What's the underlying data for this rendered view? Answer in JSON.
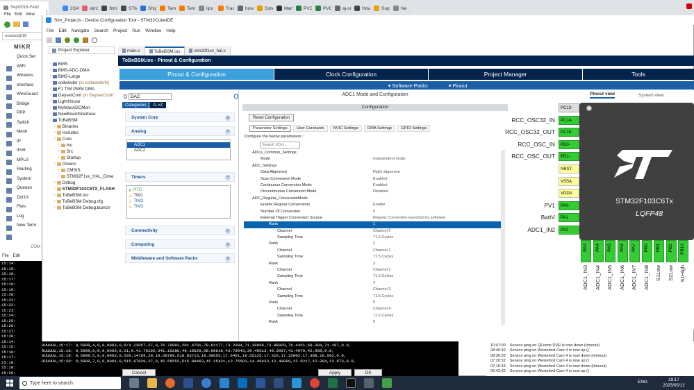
{
  "browser": {
    "active_tab_title": "Sept2018-Feb2",
    "tabs": [
      "2G4",
      "stm32",
      "Stm32",
      "STM3",
      "Shipm",
      "Temu",
      "Temu",
      "lipo b",
      "Track",
      "how t",
      "Solve",
      "Marke",
      "PVC D",
      "PVC D",
      "aj-sr0",
      "How t",
      "Suppo",
      "Ne"
    ],
    "menu": [
      "File",
      "Edit",
      "View"
    ]
  },
  "left_browser": {
    "address": "erastus@18",
    "logo": "MIKR",
    "items": [
      "Quick Set",
      "WiFi",
      "Wireless",
      "Interface",
      "WireGuard",
      "Bridge",
      "PPP",
      "Switch",
      "Mesh",
      "IP",
      "IPv6",
      "MPLS",
      "Routing",
      "System",
      "Queues",
      "Dot1X",
      "Files",
      "Log",
      "New Term"
    ],
    "com_label": "COM",
    "term_menu": [
      "File",
      "Edit"
    ],
    "times": [
      "15:14:",
      "15:15:",
      "15:16:",
      "15:17:",
      "15:18:",
      "15:19:",
      "15:20:",
      "15:21:",
      "15:22:",
      "15:23:",
      "15:24:",
      "15:25:",
      "15:26:",
      "15:27:",
      "15:28:",
      "15:14:",
      "15:15:",
      "15:16:",
      "15:17:",
      "15:18:",
      "15:19:",
      "15:20:"
    ]
  },
  "ide": {
    "title": "Stm_Projects - Device Configuration Tool - STM32CubeIDE",
    "menu": [
      "File",
      "Edit",
      "Navigate",
      "Search",
      "Project",
      "Run",
      "Window",
      "Help"
    ],
    "explorer_title": "Project Explorer",
    "editor_tabs": [
      "main.c",
      "ToBeBSM.ioc",
      "stm32f1xx_hal.c"
    ],
    "tree": [
      {
        "label": "BMS",
        "indent": 0,
        "sub": ""
      },
      {
        "label": "BMS-ADC-DMA",
        "indent": 0,
        "sub": ""
      },
      {
        "label": "BMS-Large",
        "indent": 0,
        "sub": ""
      },
      {
        "label": "coilwinder",
        "indent": 0,
        "sub": "(in coilwinderN)"
      },
      {
        "label": "F1 TIM PWM DMA",
        "indent": 0,
        "sub": ""
      },
      {
        "label": "GeyserCont",
        "indent": 0,
        "sub": "(in GeyserContr"
      },
      {
        "label": "LightHouse",
        "indent": 0,
        "sub": ""
      },
      {
        "label": "MyMacADCMon",
        "indent": 0,
        "sub": ""
      },
      {
        "label": "NewBoardInterface",
        "indent": 0,
        "sub": ""
      },
      {
        "label": "ToBeBSM",
        "indent": 0,
        "sub": ""
      },
      {
        "label": "Binaries",
        "indent": 1,
        "sub": ""
      },
      {
        "label": "Includes",
        "indent": 1,
        "sub": ""
      },
      {
        "label": "Core",
        "indent": 1,
        "sub": ""
      },
      {
        "label": "Inc",
        "indent": 2,
        "sub": ""
      },
      {
        "label": "Src",
        "indent": 2,
        "sub": ""
      },
      {
        "label": "Startup",
        "indent": 2,
        "sub": ""
      },
      {
        "label": "Drivers",
        "indent": 1,
        "sub": ""
      },
      {
        "label": "CMSIS",
        "indent": 2,
        "sub": ""
      },
      {
        "label": "STM32F1xx_HAL_Drive",
        "indent": 2,
        "sub": ""
      },
      {
        "label": "Debug",
        "indent": 1,
        "sub": ""
      },
      {
        "label": "STM32F103C6TX_FLASH",
        "indent": 1,
        "sub": ""
      },
      {
        "label": "ToBeBSM.ioc",
        "indent": 1,
        "sub": ""
      },
      {
        "label": "ToBeBSM Debug.cfg",
        "indent": 1,
        "sub": ""
      },
      {
        "label": "ToBeBSM Debug.launch",
        "indent": 1,
        "sub": ""
      }
    ],
    "ioc_title": "ToBeBSM.ioc - Pinout & Configuration",
    "main_tabs": [
      "Pinout & Configuration",
      "Clock Configuration",
      "Project Manager",
      "Tools"
    ],
    "sub_tabs": [
      "Software Packs",
      "Pinout"
    ],
    "search_value": "DAC",
    "cat_tabs": [
      "Categories",
      "A->Z"
    ],
    "sections": {
      "system_core": "System Core",
      "analog": "Analog",
      "analog_items": [
        "ADC1",
        "ADC2"
      ],
      "timers": "Timers",
      "timer_items": [
        "RTC",
        "TIM1",
        "TIM2",
        "TIM3"
      ],
      "connectivity": "Connectivity",
      "computing": "Computing",
      "middleware": "Middleware and Software Packs"
    },
    "mode_title": "ADC1 Mode and Configuration",
    "config_title": "Configuration",
    "reset_btn": "Reset Configuration",
    "param_tabs": [
      "Parameter Settings",
      "User Constants",
      "NVIC Settings",
      "DMA Settings",
      "GPIO Settings"
    ],
    "configure_hint": "Configure the below parameters :",
    "param_search_placeholder": "Search (Ctrl...",
    "params": [
      {
        "k": "ADCs_Common_Settings",
        "v": "",
        "indent": 1,
        "sel": false
      },
      {
        "k": "Mode",
        "v": "Independent mode",
        "indent": 2,
        "sel": false
      },
      {
        "k": "ADC_Settings",
        "v": "",
        "indent": 1,
        "sel": false
      },
      {
        "k": "Data Alignment",
        "v": "Right alignment",
        "indent": 2,
        "sel": false
      },
      {
        "k": "Scan Conversion Mode",
        "v": "Enabled",
        "indent": 2,
        "sel": false
      },
      {
        "k": "Continuous Conversion Mode",
        "v": "Enabled",
        "indent": 2,
        "sel": false
      },
      {
        "k": "Discontinuous Conversion Mode",
        "v": "Disabled",
        "indent": 2,
        "sel": false
      },
      {
        "k": "ADC_Regular_ConversionMode",
        "v": "",
        "indent": 1,
        "sel": false
      },
      {
        "k": "Enable Regular Conversions",
        "v": "Enable",
        "indent": 2,
        "sel": false
      },
      {
        "k": "Number Of Conversion",
        "v": "9",
        "indent": 2,
        "sel": false
      },
      {
        "k": "External Trigger Conversion Source",
        "v": "Regular Conversion launched by software",
        "indent": 2,
        "sel": false
      },
      {
        "k": "Rank",
        "v": "1",
        "indent": 3,
        "sel": true
      },
      {
        "k": "Channel",
        "v": "Channel 0",
        "indent": 4,
        "sel": false
      },
      {
        "k": "Sampling Time",
        "v": "71.5 Cycles",
        "indent": 4,
        "sel": false
      },
      {
        "k": "Rank",
        "v": "2",
        "indent": 3,
        "sel": false
      },
      {
        "k": "Channel",
        "v": "Channel 1",
        "indent": 4,
        "sel": false
      },
      {
        "k": "Sampling Time",
        "v": "71.5 Cycles",
        "indent": 4,
        "sel": false
      },
      {
        "k": "Rank",
        "v": "3",
        "indent": 3,
        "sel": false
      },
      {
        "k": "Channel",
        "v": "Channel 2",
        "indent": 4,
        "sel": false
      },
      {
        "k": "Sampling Time",
        "v": "71.5 Cycles",
        "indent": 4,
        "sel": false
      },
      {
        "k": "Rank",
        "v": "4",
        "indent": 3,
        "sel": false
      },
      {
        "k": "Channel",
        "v": "Channel 3",
        "indent": 4,
        "sel": false
      },
      {
        "k": "Sampling Time",
        "v": "71.5 Cycles",
        "indent": 4,
        "sel": false
      },
      {
        "k": "Rank",
        "v": "5",
        "indent": 3,
        "sel": false
      },
      {
        "k": "Channel",
        "v": "Channel 4",
        "indent": 4,
        "sel": false
      },
      {
        "k": "Sampling Time",
        "v": "71.5 Cycles",
        "indent": 4,
        "sel": false
      },
      {
        "k": "Rank",
        "v": "6",
        "indent": 3,
        "sel": false
      }
    ],
    "view_tabs": [
      "Pinout view",
      "System view"
    ],
    "chip_name": "STM32F103C6Tx",
    "chip_pkg": "LQFP48",
    "left_pins": [
      {
        "label": "",
        "pin": "PC13-",
        "type": "gry"
      },
      {
        "label": "RCC_OSC32_IN",
        "pin": "PC14-",
        "type": "grn"
      },
      {
        "label": "RCC_OSC32_OUT",
        "pin": "PC15-",
        "type": "grn"
      },
      {
        "label": "RCC_OSC_IN",
        "pin": "PD0-",
        "type": "grn"
      },
      {
        "label": "RCC_OSC_OUT",
        "pin": "PD1-",
        "type": "grn"
      },
      {
        "label": "",
        "pin": "NRST",
        "type": "yel"
      },
      {
        "label": "",
        "pin": "VSSA",
        "type": "yel"
      },
      {
        "label": "",
        "pin": "VDDA",
        "type": "yel"
      },
      {
        "label": "PV1",
        "pin": "PA0-",
        "type": "grn"
      },
      {
        "label": "BattV",
        "pin": "PA1",
        "type": "grn"
      },
      {
        "label": "ADC1_IN2",
        "pin": "PA2",
        "type": "grn"
      }
    ],
    "bottom_pins": [
      {
        "pin": "PA3",
        "label": "ADC1_IN3"
      },
      {
        "pin": "PA4",
        "label": "ADC1_IN4"
      },
      {
        "pin": "PA5",
        "label": "ADC1_IN5"
      },
      {
        "pin": "PA6",
        "label": "ADC1_IN6"
      },
      {
        "pin": "PA7",
        "label": "ADC1_IN7"
      },
      {
        "pin": "PB0",
        "label": "ADC1_IN8"
      },
      {
        "pin": "PB1",
        "label": "S1Low"
      },
      {
        "pin": "PB2",
        "label": "S2Low"
      },
      {
        "pin": "PB10",
        "label": "S1High"
      }
    ]
  },
  "terminal_lines": [
    "8UUUUU,15:17: 0,5998,4,0,0,0003,0,5/4.23057,27,0,76.79093,201.4701,79.81177,73.2384,71.39896,73.88929,76.4451,69.384,71.197,0.0,",
    "8UUUUU,15:18: 0,5998,0,0,0,0003,0,21,0.41.76192,341.10286,40.18529,38.08618,43.79643,39.40613,40.3957,41.4970,42.958,0.0,",
    "8UUUUU,15:19: 0,5998,5,0,0,0003,0,520.14769,29,19.38789,518.83713,18.30655,17.6451,19.55125,17.316,17.15002,17.308,18.502,0.0,",
    "8UUUUU,15:20: 0,5998,7,0,0,0001,0,515.87829,27,0,16.56552,515.89463,15.15421,13.75691,14.49433,12.40899,12.9217,12.384,12.873,0.0,"
  ],
  "log": [
    {
      "time": "10:47:00",
      "msg": "Service ping on QFoods DVR is now down (timeout)"
    },
    {
      "time": "08:46:32",
      "msg": "Service ping on Westeford Cam 4 is now up ()"
    },
    {
      "time": "08:36:33",
      "msg": "Service ping on Westeford Cam 4 is now down (timeout)"
    },
    {
      "time": "07:20:32",
      "msg": "Service ping on Westeford Cam 4 is now up ()"
    },
    {
      "time": "07:16:33",
      "msg": "Service ping on Westeford Cam 4 is now down (timeout)"
    },
    {
      "time": "06:42:32",
      "msg": "Service ping on Westeford Cam 4 is now up ()"
    }
  ],
  "dialog_buttons": {
    "cancel": "Cancel",
    "apply": "Apply",
    "ok": "OK"
  },
  "taskbar": {
    "search_placeholder": "Type here to search",
    "lang": "ENG",
    "time": "19:17",
    "date": "2025/05/12"
  },
  "colors": {
    "stm_blue": "#03234b",
    "stm_tab_blue": "#1d5fa6",
    "pin_green": "#33cc33",
    "selection": "#0a64ad"
  }
}
